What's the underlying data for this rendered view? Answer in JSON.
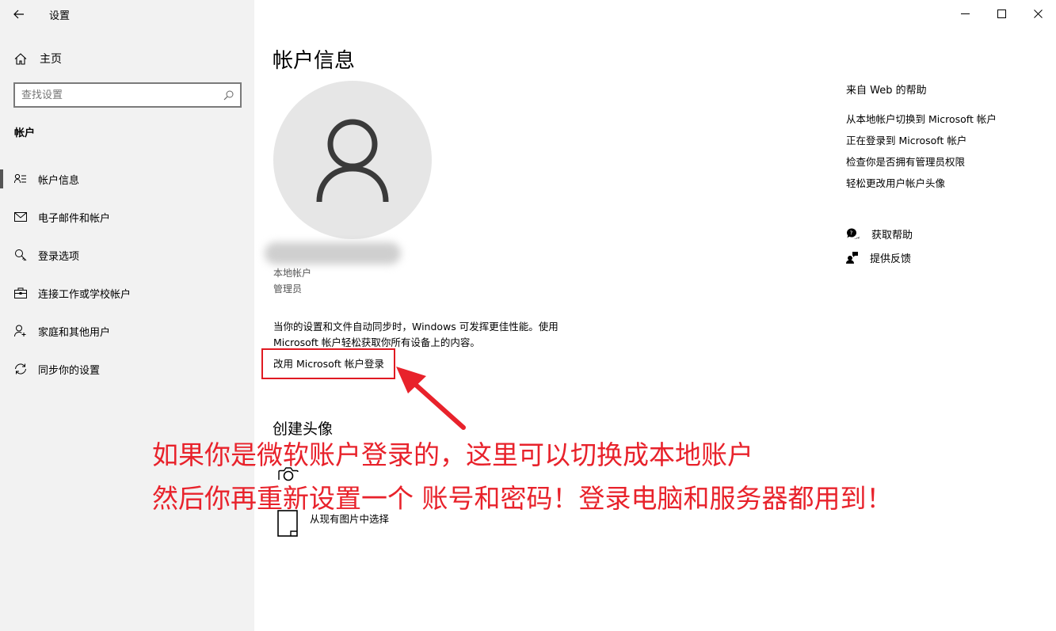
{
  "window": {
    "title": "设置"
  },
  "sidebar": {
    "home_label": "主页",
    "search_placeholder": "查找设置",
    "section_label": "帐户",
    "items": [
      {
        "label": "帐户信息",
        "icon": "account-info-icon",
        "active": true
      },
      {
        "label": "电子邮件和帐户",
        "icon": "mail-icon",
        "active": false
      },
      {
        "label": "登录选项",
        "icon": "key-icon",
        "active": false
      },
      {
        "label": "连接工作或学校帐户",
        "icon": "briefcase-icon",
        "active": false
      },
      {
        "label": "家庭和其他用户",
        "icon": "add-person-icon",
        "active": false
      },
      {
        "label": "同步你的设置",
        "icon": "sync-icon",
        "active": false
      }
    ]
  },
  "main": {
    "title": "帐户信息",
    "account_type": "本地帐户",
    "account_role": "管理员",
    "sync_text": "当你的设置和文件自动同步时，Windows 可发挥更佳性能。使用 Microsoft 帐户轻松获取你所有设备上的内容。",
    "ms_login_link": "改用 Microsoft 帐户登录",
    "create_avatar_title": "创建头像",
    "browse_label": "从现有图片中选择"
  },
  "help": {
    "title": "来自 Web 的帮助",
    "links": [
      "从本地帐户切换到 Microsoft 帐户",
      "正在登录到 Microsoft 帐户",
      "检查你是否拥有管理员权限",
      "轻松更改用户帐户头像"
    ],
    "get_help": "获取帮助",
    "feedback": "提供反馈"
  },
  "annotation": {
    "line1": "如果你是微软账户登录的，这里可以切换成本地账户",
    "line2": "然后你再重新设置一个 账号和密码！登录电脑和服务器都用到！",
    "color": "#e8222b"
  }
}
